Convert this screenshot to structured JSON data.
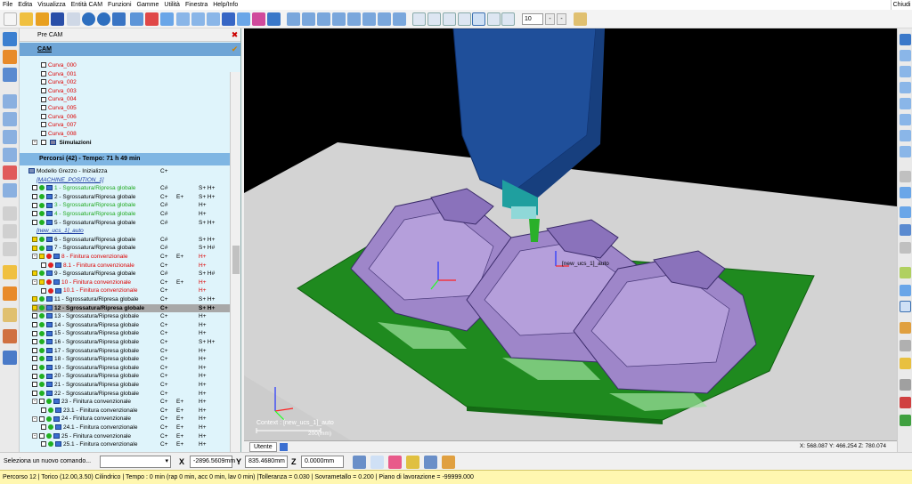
{
  "menubar": {
    "items": [
      "File",
      "Edita",
      "Visualizza",
      "Entità CAM",
      "Funzioni",
      "Gamme",
      "Utilità",
      "Finestra",
      "Help/Info"
    ],
    "close_label": "Chiudi"
  },
  "toolbar": {
    "zoom_value": "10"
  },
  "tree": {
    "precam_label": "Pre CAM",
    "cam_label": "CAM",
    "curves": [
      "Curva_000",
      "Curva_001",
      "Curva_002",
      "Curva_003",
      "Curva_004",
      "Curva_005",
      "Curva_006",
      "Curva_007",
      "Curva_008"
    ],
    "simulazioni_label": "Simulazioni",
    "percorsi_label": "Percorsi (42) - Tempo: 71 h 49 min",
    "rows": [
      {
        "text": "Modello Grezzo - Inizializza",
        "c2": "C+",
        "c3": "",
        "c4": "",
        "color": "#000000",
        "kind": "model"
      },
      {
        "text": "[MACHINE_POSITION_1]",
        "c2": "",
        "c3": "",
        "c4": "",
        "color": "#1a3aa0",
        "kind": "section"
      },
      {
        "text": "1 - Sgrossatura/Ripresa globale",
        "c2": "C#",
        "c3": "",
        "c4": "S+ H+",
        "color": "#22aa22",
        "kind": "op"
      },
      {
        "text": "2 - Sgrossatura/Ripresa globale",
        "c2": "C+",
        "c3": "E+",
        "c4": "S+ H+",
        "color": "#000000",
        "kind": "op"
      },
      {
        "text": "3 - Sgrossatura/Ripresa globale",
        "c2": "C#",
        "c3": "",
        "c4": "H+",
        "color": "#22aa22",
        "kind": "op"
      },
      {
        "text": "4 - Sgrossatura/Ripresa globale",
        "c2": "C#",
        "c3": "",
        "c4": "H+",
        "color": "#22aa22",
        "kind": "op"
      },
      {
        "text": "5 - Sgrossatura/Ripresa globale",
        "c2": "C#",
        "c3": "",
        "c4": "S+ H+",
        "color": "#000000",
        "kind": "op"
      },
      {
        "text": "[new_ucs_1]_auto",
        "c2": "",
        "c3": "",
        "c4": "",
        "color": "#1a3aa0",
        "kind": "section"
      },
      {
        "text": "6 - Sgrossatura/Ripresa globale",
        "c2": "C#",
        "c3": "",
        "c4": "S+ H+",
        "color": "#000000",
        "kind": "op"
      },
      {
        "text": "7 - Sgrossatura/Ripresa globale",
        "c2": "C#",
        "c3": "",
        "c4": "S+ H#",
        "color": "#000000",
        "kind": "op"
      },
      {
        "text": "8 - Finitura convenzionale",
        "c2": "C+",
        "c3": "E+",
        "c4": "H+",
        "color": "#dd0000",
        "kind": "fin"
      },
      {
        "text": "8.1 - Finitura convenzionale",
        "c2": "C+",
        "c3": "",
        "c4": "H+",
        "color": "#dd0000",
        "kind": "sub"
      },
      {
        "text": "9 - Sgrossatura/Ripresa globale",
        "c2": "C#",
        "c3": "",
        "c4": "S+ H#",
        "color": "#000000",
        "kind": "op"
      },
      {
        "text": "10 - Finitura convenzionale",
        "c2": "C+",
        "c3": "E+",
        "c4": "H+",
        "color": "#dd0000",
        "kind": "fin"
      },
      {
        "text": "10.1 - Finitura convenzionale",
        "c2": "C+",
        "c3": "",
        "c4": "H+",
        "color": "#dd0000",
        "kind": "sub"
      },
      {
        "text": "11 - Sgrossatura/Ripresa globale",
        "c2": "C+",
        "c3": "",
        "c4": "S+ H+",
        "color": "#000000",
        "kind": "op"
      },
      {
        "text": "12 - Sgrossatura/Ripresa globale",
        "c2": "C+",
        "c3": "",
        "c4": "S+ H+",
        "color": "#000000",
        "kind": "selected"
      },
      {
        "text": "13 - Sgrossatura/Ripresa globale",
        "c2": "C+",
        "c3": "",
        "c4": "H+",
        "color": "#000000",
        "kind": "op"
      },
      {
        "text": "14 - Sgrossatura/Ripresa globale",
        "c2": "C+",
        "c3": "",
        "c4": "H+",
        "color": "#000000",
        "kind": "op"
      },
      {
        "text": "15 - Sgrossatura/Ripresa globale",
        "c2": "C+",
        "c3": "",
        "c4": "H+",
        "color": "#000000",
        "kind": "op"
      },
      {
        "text": "16 - Sgrossatura/Ripresa globale",
        "c2": "C+",
        "c3": "",
        "c4": "S+ H+",
        "color": "#000000",
        "kind": "op"
      },
      {
        "text": "17 - Sgrossatura/Ripresa globale",
        "c2": "C+",
        "c3": "",
        "c4": "H+",
        "color": "#000000",
        "kind": "op"
      },
      {
        "text": "18 - Sgrossatura/Ripresa globale",
        "c2": "C+",
        "c3": "",
        "c4": "H+",
        "color": "#000000",
        "kind": "op"
      },
      {
        "text": "19 - Sgrossatura/Ripresa globale",
        "c2": "C+",
        "c3": "",
        "c4": "H+",
        "color": "#000000",
        "kind": "op"
      },
      {
        "text": "20 - Sgrossatura/Ripresa globale",
        "c2": "C+",
        "c3": "",
        "c4": "H+",
        "color": "#000000",
        "kind": "op"
      },
      {
        "text": "21 - Sgrossatura/Ripresa globale",
        "c2": "C+",
        "c3": "",
        "c4": "H+",
        "color": "#000000",
        "kind": "op"
      },
      {
        "text": "22 - Sgrossatura/Ripresa globale",
        "c2": "C+",
        "c3": "",
        "c4": "H+",
        "color": "#000000",
        "kind": "op"
      },
      {
        "text": "23 - Finitura convenzionale",
        "c2": "C+",
        "c3": "E+",
        "c4": "H+",
        "color": "#000000",
        "kind": "fin"
      },
      {
        "text": "23.1 - Finitura convenzionale",
        "c2": "C+",
        "c3": "E+",
        "c4": "H+",
        "color": "#000000",
        "kind": "sub"
      },
      {
        "text": "24 - Finitura convenzionale",
        "c2": "C+",
        "c3": "E+",
        "c4": "H+",
        "color": "#000000",
        "kind": "fin"
      },
      {
        "text": "24.1 - Finitura convenzionale",
        "c2": "C+",
        "c3": "E+",
        "c4": "H+",
        "color": "#000000",
        "kind": "sub"
      },
      {
        "text": "25 - Finitura convenzionale",
        "c2": "C+",
        "c3": "E+",
        "c4": "H+",
        "color": "#000000",
        "kind": "fin"
      },
      {
        "text": "25.1 - Finitura convenzionale",
        "c2": "C+",
        "c3": "E+",
        "c4": "H+",
        "color": "#000000",
        "kind": "sub"
      }
    ]
  },
  "viewport": {
    "context_label": "Context : [new_ucs_1]_auto",
    "scale_label": "200(mm)",
    "ucs_label": "[new_ucs_1]_auto",
    "tab_label": "Utente",
    "coords": "X: 568.087   Y: 466.254   Z: 780.074"
  },
  "cmdbar": {
    "prompt": "Seleziona un nuovo comando...",
    "x_label": "X",
    "x_value": "-2896.5609mm",
    "y_label": "Y",
    "y_value": "835.4680mm",
    "z_label": "Z",
    "z_value": "0.0000mm"
  },
  "statusbar": {
    "text": "Percorso 12 | Torico (12.00,3.50) Cilindrico | Tempo : 0 min (rap 0 min, acc 0 min, lav 0 min) |Tolleranza = 0.030 | Sovrametallo = 0.200 | Piano di lavorazione = -99999.000"
  },
  "colors": {
    "tree_bg": "#dff4fb",
    "stock_green": "#1f8a1f",
    "part_purple": "#9e86c9",
    "spindle_blue": "#1f4f9a",
    "status_yellow": "#fff7b0"
  }
}
